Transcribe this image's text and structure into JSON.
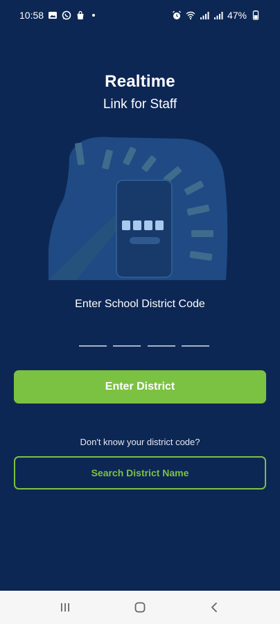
{
  "status_bar": {
    "time": "10:58",
    "battery": "47%",
    "left_icons": [
      "gallery-icon",
      "whatsapp-icon",
      "shopping-bag-icon"
    ],
    "right_icons": [
      "alarm-icon",
      "wifi-icon",
      "signal-icon",
      "signal-icon",
      "battery-icon"
    ]
  },
  "header": {
    "title": "Realtime",
    "subtitle": "Link for Staff"
  },
  "form": {
    "prompt": "Enter School District Code",
    "code_slots": [
      "",
      "",
      "",
      ""
    ],
    "enter_button_label": "Enter District"
  },
  "help": {
    "question": "Don't know your district code?",
    "search_button_label": "Search District Name"
  },
  "colors": {
    "background": "#0d2754",
    "accent": "#7cc242",
    "illustration_blob": "#1f4a83",
    "illustration_dashes": "#3f6b8d",
    "code_squares": "#a9c8ee"
  },
  "nav_bar": {
    "buttons": [
      "recent-apps-icon",
      "home-icon",
      "back-icon"
    ]
  }
}
